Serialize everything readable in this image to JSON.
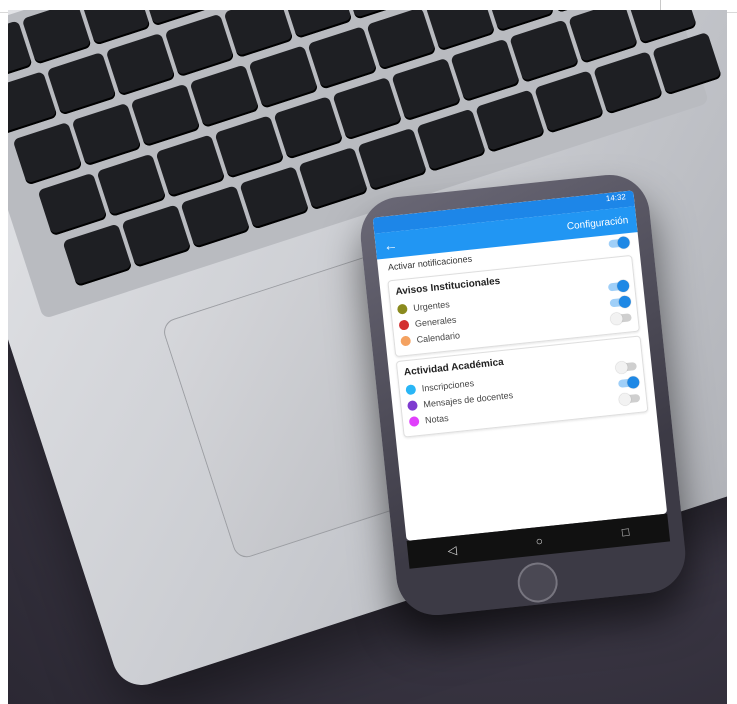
{
  "phone": {
    "status_time": "14:32",
    "appbar_title": "Configuración",
    "back_icon": "arrow-left-icon",
    "activar_label": "Activar notificaciones",
    "activar_on": true,
    "cards": [
      {
        "title": "Avisos Institucionales",
        "items": [
          {
            "label": "Urgentes",
            "color": "#8a8a1e",
            "on": true
          },
          {
            "label": "Generales",
            "color": "#d32f2f",
            "on": true
          },
          {
            "label": "Calendario",
            "color": "#f4a261",
            "on": false
          }
        ]
      },
      {
        "title": "Actividad Académica",
        "items": [
          {
            "label": "Inscripciones",
            "color": "#29b6f6",
            "on": false
          },
          {
            "label": "Mensajes de docentes",
            "color": "#7e3bd0",
            "on": true
          },
          {
            "label": "Notas",
            "color": "#e040fb",
            "on": false
          }
        ]
      }
    ],
    "nav": {
      "back": "◁",
      "home": "○",
      "recent": "□"
    }
  },
  "colors": {
    "appbar": "#2196f3",
    "accent": "#1e88e5"
  }
}
